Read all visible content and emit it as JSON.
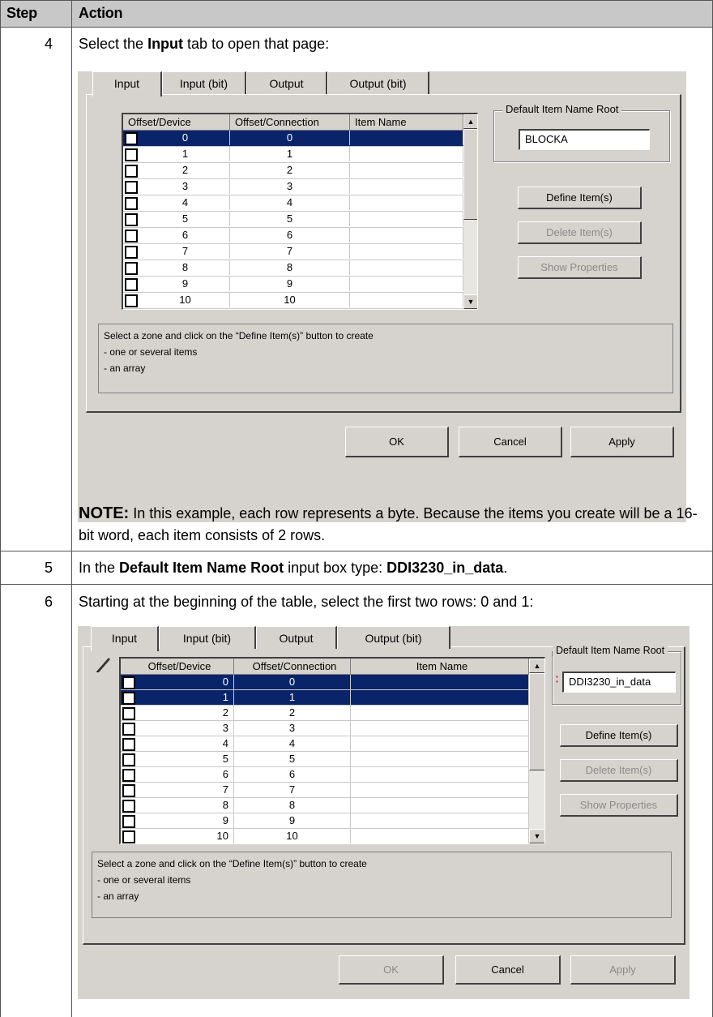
{
  "header": {
    "step": "Step",
    "action": "Action"
  },
  "step4": {
    "num": "4",
    "text_prefix": "Select the ",
    "text_bold": "Input",
    "text_suffix": " tab to open that page:",
    "note_label": "NOTE:",
    "note_text": " In this example, each row represents a byte. Because the items you create will be a 16-bit word, each item consists of 2 rows."
  },
  "step5": {
    "num": "5",
    "text_prefix": "In the ",
    "text_bold": "Default Item Name Root",
    "text_mid": " input box type: ",
    "text_bold2": "DDI3230_in_data",
    "text_suffix": "."
  },
  "step6": {
    "num": "6",
    "text": "Starting at the beginning of the table, select the first two rows: 0 and 1:"
  },
  "dialog1": {
    "tabs": [
      "Input",
      "Input (bit)",
      "Output",
      "Output (bit)"
    ],
    "columns": [
      "Offset/Device",
      "Offset/Connection",
      "Item Name"
    ],
    "rows": [
      {
        "device": "0",
        "connection": "0",
        "name": ""
      },
      {
        "device": "1",
        "connection": "1",
        "name": ""
      },
      {
        "device": "2",
        "connection": "2",
        "name": ""
      },
      {
        "device": "3",
        "connection": "3",
        "name": ""
      },
      {
        "device": "4",
        "connection": "4",
        "name": ""
      },
      {
        "device": "5",
        "connection": "5",
        "name": ""
      },
      {
        "device": "6",
        "connection": "6",
        "name": ""
      },
      {
        "device": "7",
        "connection": "7",
        "name": ""
      },
      {
        "device": "8",
        "connection": "8",
        "name": ""
      },
      {
        "device": "9",
        "connection": "9",
        "name": ""
      },
      {
        "device": "10",
        "connection": "10",
        "name": ""
      }
    ],
    "group_label": "Default Item Name Root",
    "root_value": "BLOCKA",
    "define_btn": "Define Item(s)",
    "delete_btn": "Delete Item(s)",
    "props_btn": "Show Properties",
    "info_lines": [
      "Select a zone and click on the “Define Item(s)” button to create",
      "- one or several items",
      "- an array"
    ],
    "ok": "OK",
    "cancel": "Cancel",
    "apply": "Apply"
  },
  "dialog2": {
    "tabs": [
      "Input",
      "Input (bit)",
      "Output",
      "Output (bit)"
    ],
    "columns": [
      "Offset/Device",
      "Offset/Connection",
      "Item Name"
    ],
    "rows": [
      {
        "device": "0",
        "connection": "0",
        "name": ""
      },
      {
        "device": "1",
        "connection": "1",
        "name": ""
      },
      {
        "device": "2",
        "connection": "2",
        "name": ""
      },
      {
        "device": "3",
        "connection": "3",
        "name": ""
      },
      {
        "device": "4",
        "connection": "4",
        "name": ""
      },
      {
        "device": "5",
        "connection": "5",
        "name": ""
      },
      {
        "device": "6",
        "connection": "6",
        "name": ""
      },
      {
        "device": "7",
        "connection": "7",
        "name": ""
      },
      {
        "device": "8",
        "connection": "8",
        "name": ""
      },
      {
        "device": "9",
        "connection": "9",
        "name": ""
      },
      {
        "device": "10",
        "connection": "10",
        "name": ""
      }
    ],
    "group_label": "Default Item Name Root",
    "root_value": "DDI3230_in_data",
    "define_btn": "Define Item(s)",
    "delete_btn": "Delete Item(s)",
    "props_btn": "Show Properties",
    "info_lines": [
      "Select a zone and click on the “Define Item(s)” button to create",
      "- one or several items",
      "- an array"
    ],
    "ok": "OK",
    "cancel": "Cancel",
    "apply": "Apply"
  }
}
